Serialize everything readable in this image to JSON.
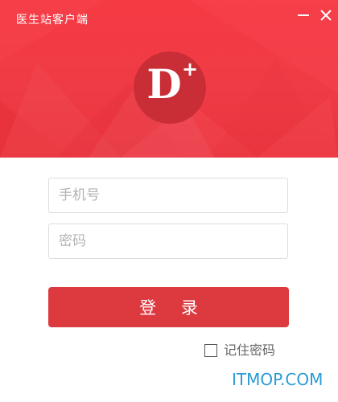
{
  "window": {
    "title": "医生站客户端"
  },
  "logo": {
    "letter": "D",
    "superscript": "+"
  },
  "form": {
    "phone": {
      "value": "",
      "placeholder": "手机号"
    },
    "password": {
      "value": "",
      "placeholder": "密码"
    },
    "login_label": "登 录",
    "remember_label": "记住密码",
    "remember_checked": false
  },
  "watermark": "ITMOP.COM",
  "colors": {
    "header_red": "#f63a44",
    "logo_circle": "#c92e37",
    "login_button": "#dd3a3f",
    "watermark": "#2a9bd6",
    "placeholder": "#b3b3b3",
    "border": "#dcdcdc"
  },
  "icons": {
    "minimize": "minimize-icon",
    "close": "close-icon"
  }
}
